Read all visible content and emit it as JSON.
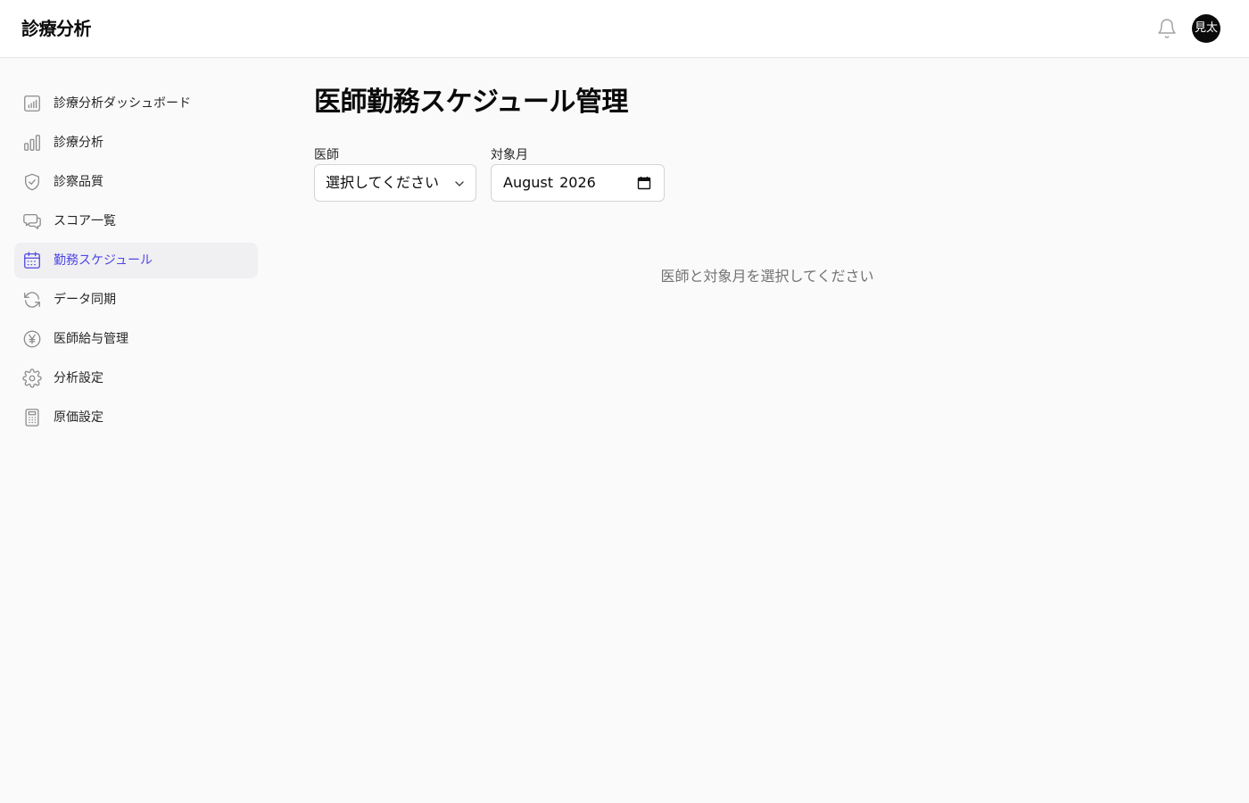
{
  "header": {
    "app_title": "診療分析",
    "avatar_text": "見太"
  },
  "sidebar": {
    "items": [
      {
        "label": "診療分析ダッシュボード",
        "icon": "bar-chart-square-icon",
        "active": false
      },
      {
        "label": "診療分析",
        "icon": "bar-chart-icon",
        "active": false
      },
      {
        "label": "診察品質",
        "icon": "shield-check-icon",
        "active": false
      },
      {
        "label": "スコア一覧",
        "icon": "chat-bubbles-icon",
        "active": false
      },
      {
        "label": "勤務スケジュール",
        "icon": "calendar-icon",
        "active": true
      },
      {
        "label": "データ同期",
        "icon": "refresh-icon",
        "active": false
      },
      {
        "label": "医師給与管理",
        "icon": "yen-circle-icon",
        "active": false
      },
      {
        "label": "分析設定",
        "icon": "gear-icon",
        "active": false
      },
      {
        "label": "原価設定",
        "icon": "calculator-icon",
        "active": false
      }
    ]
  },
  "main": {
    "title": "医師勤務スケジュール管理",
    "doctor_field": {
      "label": "医師",
      "value": "選択してください"
    },
    "month_field": {
      "label": "対象月",
      "value": "August 2026"
    },
    "empty_message": "医師と対象月を選択してください"
  },
  "colors": {
    "accent": "#4f46e5",
    "active_bg": "#f0f0f2",
    "muted_text": "#737373",
    "background": "#fafafa"
  }
}
